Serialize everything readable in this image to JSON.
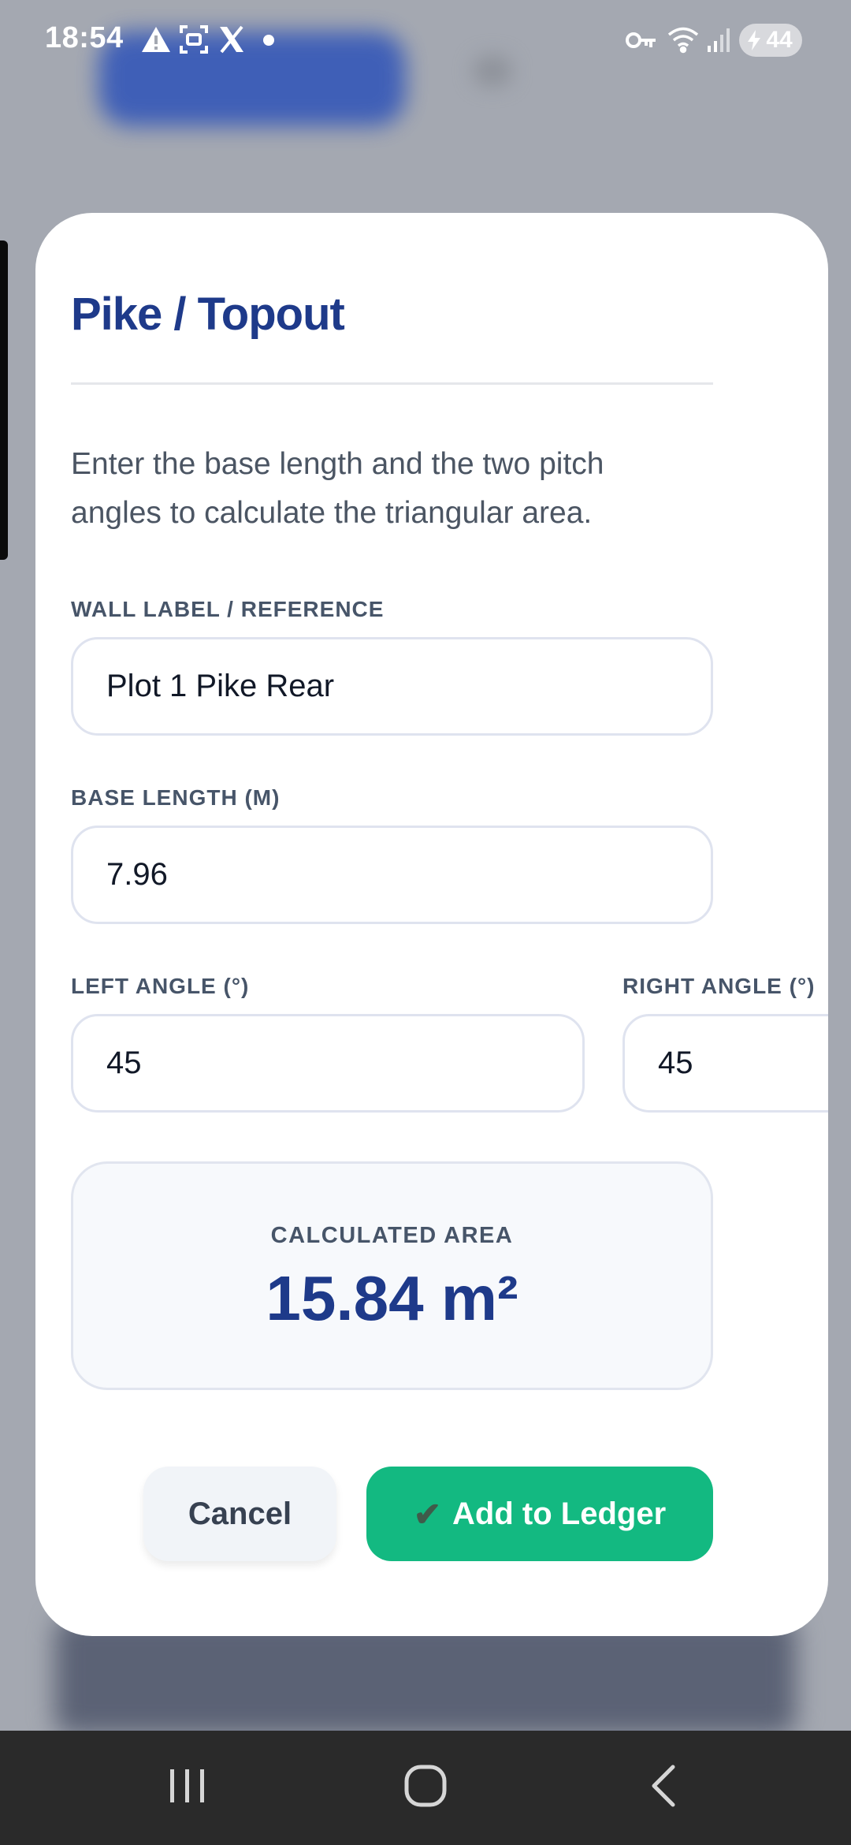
{
  "status_bar": {
    "time": "18:54",
    "battery": "44",
    "icons": [
      "alert-triangle-icon",
      "screenshot-icon",
      "x-app-icon",
      "dot-icon",
      "vpn-key-icon",
      "wifi-icon",
      "signal-icon",
      "battery-charging-icon"
    ]
  },
  "modal": {
    "title": "Pike / Topout",
    "description": "Enter the base length and the two pitch angles to calculate the triangular area.",
    "wall_label": {
      "label": "WALL LABEL / REFERENCE",
      "value": "Plot 1 Pike Rear"
    },
    "base_length": {
      "label": "BASE LENGTH (M)",
      "value": "7.96"
    },
    "left_angle": {
      "label": "LEFT ANGLE (°)",
      "value": "45"
    },
    "right_angle": {
      "label": "RIGHT ANGLE (°)",
      "value": "45"
    },
    "result": {
      "label": "CALCULATED AREA",
      "value": "15.84 m²"
    },
    "buttons": {
      "cancel": "Cancel",
      "add_check": "✔",
      "add": "Add to Ledger"
    }
  },
  "nav_bar": {
    "items": [
      "recent-apps-icon",
      "home-icon",
      "back-icon"
    ]
  },
  "colors": {
    "title": "#1e3a8a",
    "accent_green": "#13b981",
    "label": "#475569"
  }
}
